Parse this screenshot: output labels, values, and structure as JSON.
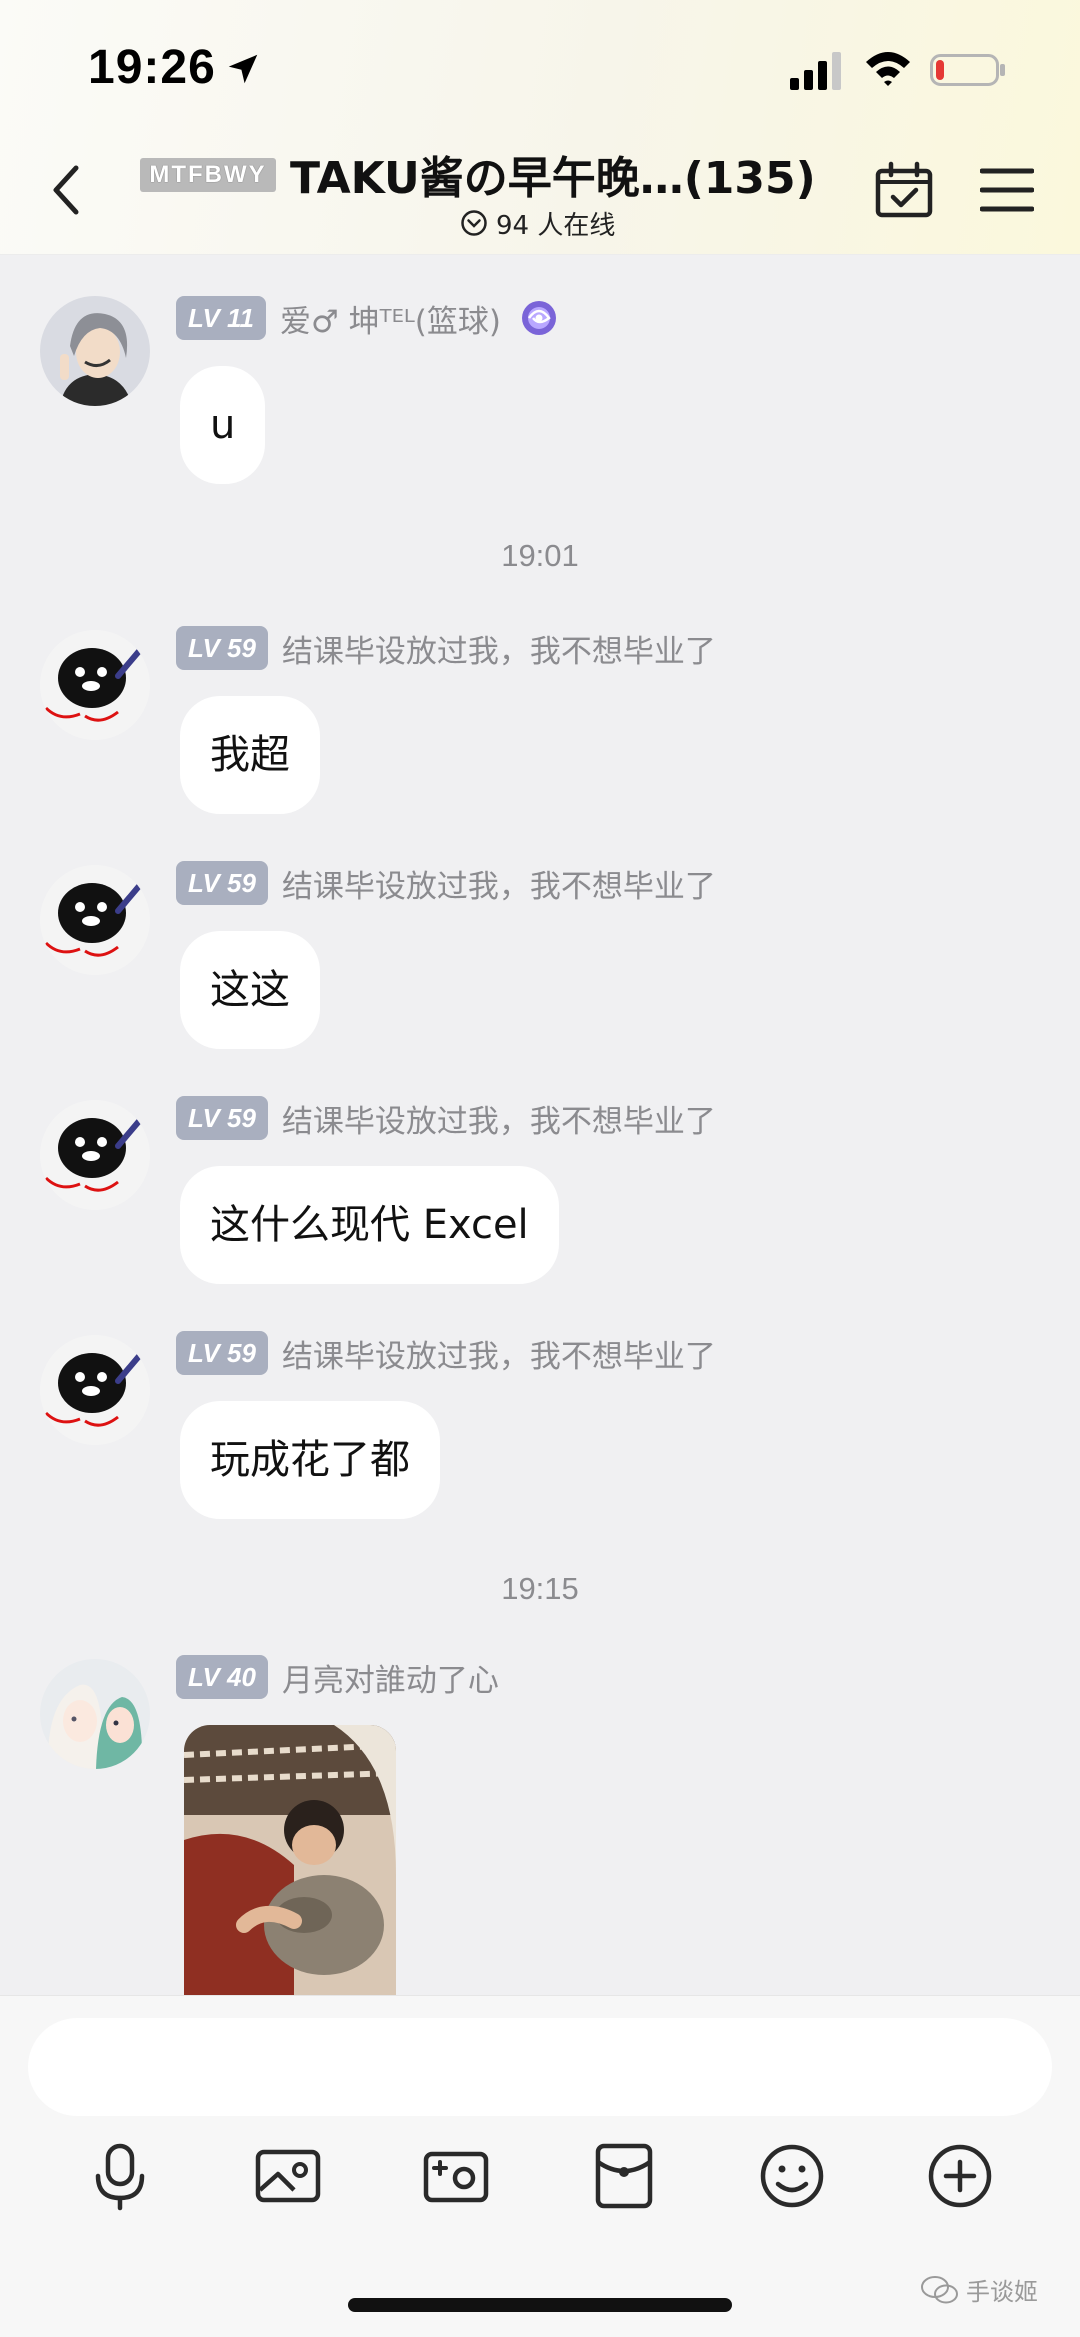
{
  "status_bar": {
    "time": "19:26",
    "location_icon": "location-arrow-icon",
    "signal_icon": "cellular-signal-icon",
    "wifi_icon": "wifi-icon",
    "battery_icon": "battery-low-icon",
    "battery_level": 0.12,
    "battery_color": "#e53935"
  },
  "header": {
    "back_icon": "chevron-left-icon",
    "logo_text": "MTFBWY",
    "title": "TAKU酱の早午晚…(135)",
    "online_text": "94 人在线",
    "online_icon": "chevron-down-circle-icon",
    "calendar_icon": "calendar-check-icon",
    "menu_icon": "hamburger-menu-icon"
  },
  "messages": [
    {
      "type": "text",
      "avatar": "avatar-anime-grey-hair",
      "level": "LV 11",
      "nickname": "爱♂ 坤ᵀᴱᴸ(篮球)",
      "badge_icon": "galaxy-sticker-icon",
      "text": "u"
    },
    {
      "type": "time",
      "text": "19:01"
    },
    {
      "type": "text",
      "avatar": "avatar-black-penguin",
      "level": "LV 59",
      "nickname": "结课毕设放过我，我不想毕业了",
      "text": "我超"
    },
    {
      "type": "text",
      "avatar": "avatar-black-penguin",
      "level": "LV 59",
      "nickname": "结课毕设放过我，我不想毕业了",
      "text": "这这"
    },
    {
      "type": "text",
      "avatar": "avatar-black-penguin",
      "level": "LV 59",
      "nickname": "结课毕设放过我，我不想毕业了",
      "text": "这什么现代 Excel"
    },
    {
      "type": "text",
      "avatar": "avatar-black-penguin",
      "level": "LV 59",
      "nickname": "结课毕设放过我，我不想毕业了",
      "text": "玩成花了都"
    },
    {
      "type": "time",
      "text": "19:15"
    },
    {
      "type": "image",
      "avatar": "avatar-anime-two-girls",
      "level": "LV 40",
      "nickname": "月亮对誰动了心",
      "image_icon": "photo-person-hugging-cat"
    }
  ],
  "input": {
    "placeholder": ""
  },
  "toolbar": {
    "items": [
      "microphone-icon",
      "gallery-icon",
      "camera-icon",
      "red-packet-icon",
      "emoji-icon",
      "plus-icon"
    ]
  },
  "watermark": {
    "text": "手谈姬",
    "icon": "wechat-icon"
  },
  "colors": {
    "level_badge": "#a9afbf",
    "nickname": "#8b8b8f",
    "bubble": "#ffffff",
    "background": "#f0f0f2"
  }
}
